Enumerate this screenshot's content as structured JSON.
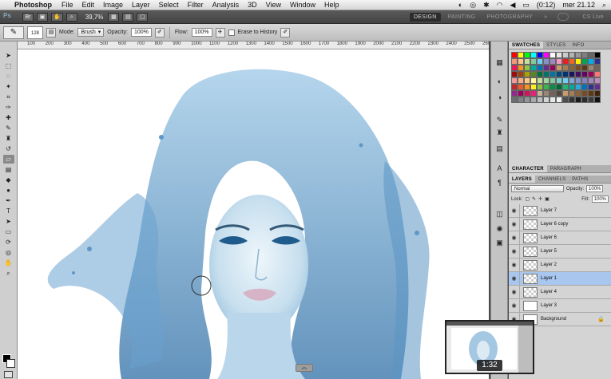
{
  "menubar": {
    "app_name": "Photoshop",
    "items": [
      "File",
      "Edit",
      "Image",
      "Layer",
      "Select",
      "Filter",
      "Analysis",
      "3D",
      "View",
      "Window",
      "Help"
    ],
    "battery": "(0:12)",
    "clock": "mer 21.12"
  },
  "appbar": {
    "ps_label": "Ps",
    "zoom": "39,7%",
    "workspaces": [
      "DESIGN",
      "PAINTING",
      "PHOTOGRAPHY"
    ],
    "active_workspace": "DESIGN",
    "more": "»",
    "cs_live": "CS Live"
  },
  "options": {
    "brush_size": "128",
    "mode_label": "Mode:",
    "mode_value": "Brush",
    "opacity_label": "Opacity:",
    "opacity_value": "100%",
    "flow_label": "Flow:",
    "flow_value": "100%",
    "erase_history": "Erase to History"
  },
  "ruler_ticks": [
    "100",
    "200",
    "300",
    "400",
    "500",
    "600",
    "700",
    "800",
    "900",
    "1000",
    "1100",
    "1200",
    "1300",
    "1400",
    "1500",
    "1600",
    "1700",
    "1800",
    "1900",
    "2000",
    "2100",
    "2200",
    "2300",
    "2400",
    "2500",
    "2600",
    "2700"
  ],
  "panels": {
    "top_tabs": [
      "SWATCHES",
      "STYLES",
      "INFO"
    ],
    "mid_tabs": [
      "CHARACTER",
      "PARAGRAPH"
    ],
    "layer_tabs": [
      "LAYERS",
      "CHANNELS",
      "PATHS"
    ],
    "blend_mode": "Normal",
    "opacity_label": "Opacity:",
    "opacity_value": "100%",
    "lock_label": "Lock:",
    "fill_label": "Fill:",
    "fill_value": "100%",
    "layers": [
      {
        "name": "Layer 7",
        "thumb": "transparent",
        "selected": false
      },
      {
        "name": "Layer 6 copy",
        "thumb": "transparent",
        "selected": false
      },
      {
        "name": "Layer 6",
        "thumb": "transparent",
        "selected": false
      },
      {
        "name": "Layer 5",
        "thumb": "transparent",
        "selected": false
      },
      {
        "name": "Layer 2",
        "thumb": "transparent",
        "selected": false
      },
      {
        "name": "Layer 1",
        "thumb": "transparent",
        "selected": true
      },
      {
        "name": "Layer 4",
        "thumb": "transparent",
        "selected": false
      },
      {
        "name": "Layer 3",
        "thumb": "white",
        "selected": false
      },
      {
        "name": "Background",
        "thumb": "white",
        "selected": false
      }
    ]
  },
  "video": {
    "timestamp": "1:32"
  },
  "colors": {
    "selected_layer": "#a8c6ee",
    "water_blue": "#4f8fc0"
  }
}
